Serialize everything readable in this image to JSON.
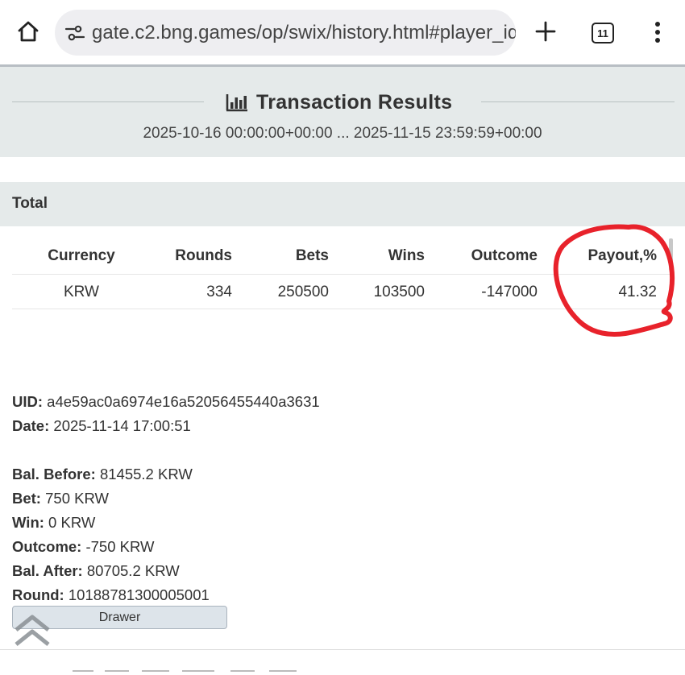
{
  "browser": {
    "url": "gate.c2.bng.games/op/swix/history.html#player_id",
    "tab_count": "11",
    "icons": {
      "home": "home-icon",
      "site_info": "site-settings-icon",
      "new_tab": "plus-icon",
      "tabs": "tab-switcher-icon",
      "menu": "more-vert-icon"
    }
  },
  "header": {
    "title": "Transaction Results",
    "title_icon": "bar-chart-icon",
    "date_range": "2025-10-16 00:00:00+00:00 ... 2025-11-15 23:59:59+00:00"
  },
  "total": {
    "label": "Total",
    "columns": [
      "Currency",
      "Rounds",
      "Bets",
      "Wins",
      "Outcome",
      "Payout,%"
    ],
    "rows": [
      [
        "KRW",
        "334",
        "250500",
        "103500",
        "-147000",
        "41.32"
      ]
    ]
  },
  "transaction": {
    "uid_label": "UID:",
    "uid": "a4e59ac0a6974e16a52056455440a3631",
    "date_label": "Date:",
    "date": "2025-11-14 17:00:51",
    "bal_before_label": "Bal. Before:",
    "bal_before": "81455.2 KRW",
    "bet_label": "Bet:",
    "bet": "750 KRW",
    "win_label": "Win:",
    "win": "0 KRW",
    "outcome_label": "Outcome:",
    "outcome": "-750 KRW",
    "bal_after_label": "Bal. After:",
    "bal_after": "80705.2 KRW",
    "round_label": "Round:",
    "round": "10188781300005001",
    "drawer_label": "Drawer"
  },
  "colors": {
    "header_band": "#e5eaea",
    "annotation": "#e8222b",
    "drawer_button": "#dde4ea"
  }
}
